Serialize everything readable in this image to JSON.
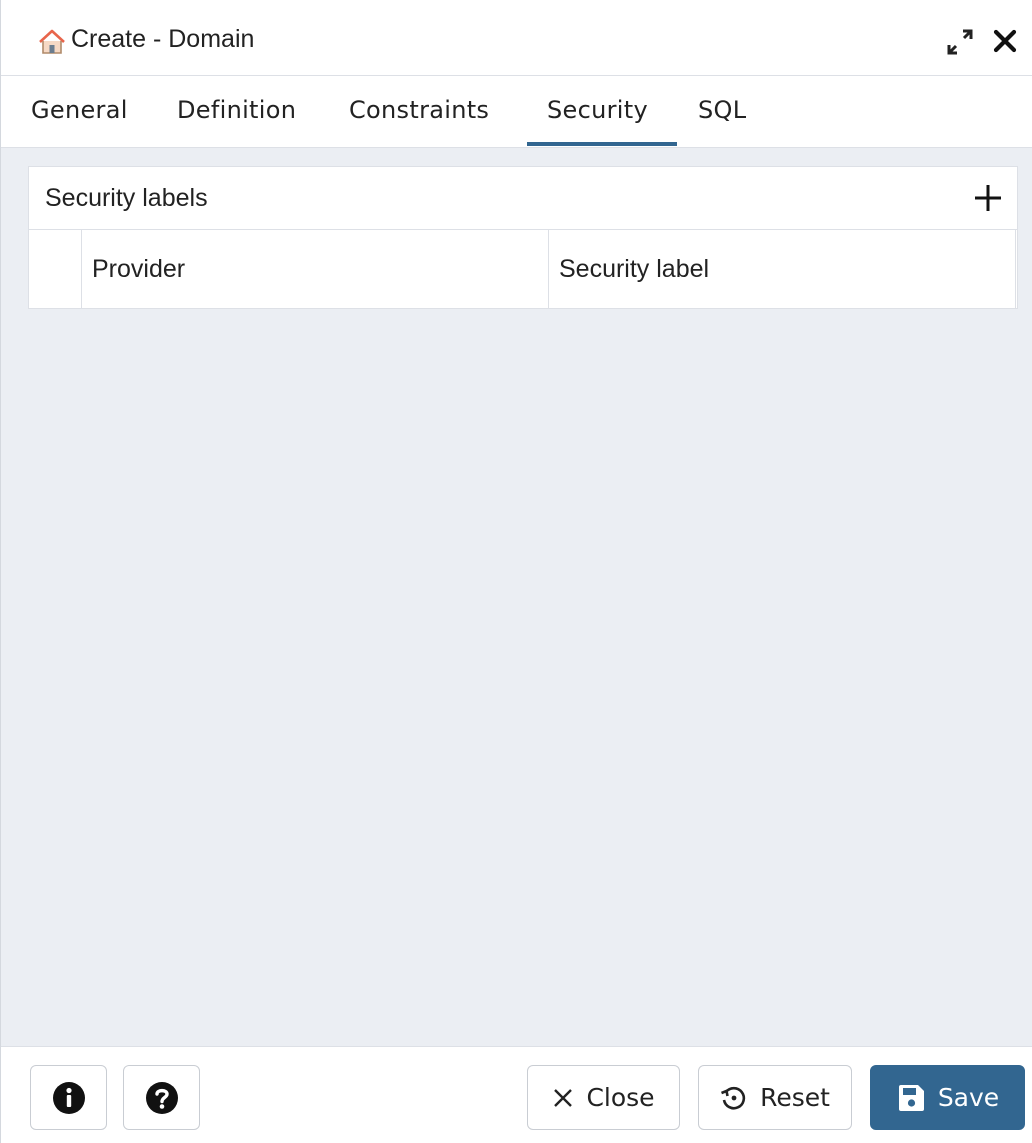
{
  "dialog": {
    "title": "Create - Domain",
    "title_icon": "home-icon",
    "expand_icon": "expand-icon",
    "close_icon": "close-icon"
  },
  "tabs": [
    {
      "label": "General",
      "active": false
    },
    {
      "label": "Definition",
      "active": false
    },
    {
      "label": "Constraints",
      "active": false
    },
    {
      "label": "Security",
      "active": true
    },
    {
      "label": "SQL",
      "active": false
    }
  ],
  "security_panel": {
    "title": "Security labels",
    "add_icon": "plus-icon",
    "columns": [
      "Provider",
      "Security label"
    ],
    "rows": []
  },
  "footer": {
    "info_icon": "info-icon",
    "help_icon": "help-icon",
    "close_label": "Close",
    "reset_label": "Reset",
    "save_label": "Save"
  },
  "colors": {
    "accent": "#326690",
    "background": "#ebeef3",
    "border": "#dde0e6",
    "home_icon_roof": "#e8654b"
  }
}
